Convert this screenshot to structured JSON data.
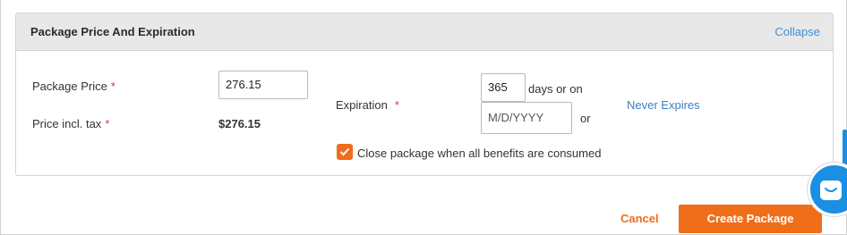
{
  "panel": {
    "title": "Package Price And Expiration",
    "collapse_label": "Collapse"
  },
  "price": {
    "label": "Package Price",
    "required_mark": "*",
    "value": "276.15"
  },
  "price_incl_tax": {
    "label": "Price incl. tax",
    "required_mark": "*",
    "value": "$276.15"
  },
  "expiration": {
    "label": "Expiration",
    "required_mark": "*",
    "days_value": "365",
    "days_suffix": "days or on",
    "date_placeholder": "M/D/YYYY",
    "or_text": "or",
    "never_expires_label": "Never Expires"
  },
  "close_package": {
    "checked": true,
    "label": "Close package when all benefits are consumed"
  },
  "actions": {
    "cancel_label": "Cancel",
    "create_label": "Create Package"
  },
  "colors": {
    "accent": "#f06d1a",
    "link": "#3d8fd8",
    "required": "#e0343a",
    "chat": "#1a8fe3"
  },
  "icons": {
    "checkbox": "checkmark-icon",
    "chat": "chat-bubble-icon"
  }
}
